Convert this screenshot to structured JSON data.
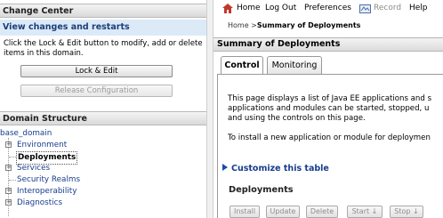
{
  "change_center": {
    "title": "Change Center",
    "view_changes": "View changes and restarts",
    "description": "Click the Lock & Edit button to modify, add or delete items in this domain.",
    "lock_edit_label": "Lock & Edit",
    "release_label": "Release Configuration"
  },
  "domain_structure": {
    "title": "Domain Structure",
    "root": "base_domain",
    "items": [
      {
        "label": "Environment",
        "expandable": true
      },
      {
        "label": "Deployments",
        "expandable": false,
        "selected": true
      },
      {
        "label": "Services",
        "expandable": true
      },
      {
        "label": "Security Realms",
        "expandable": false
      },
      {
        "label": "Interoperability",
        "expandable": true
      },
      {
        "label": "Diagnostics",
        "expandable": true
      }
    ]
  },
  "topbar": {
    "home": "Home",
    "logout": "Log Out",
    "preferences": "Preferences",
    "record": "Record",
    "help": "Help"
  },
  "breadcrumb": {
    "home": "Home",
    "separator": ">",
    "current": "Summary of Deployments"
  },
  "main": {
    "title": "Summary of Deployments",
    "tabs": [
      {
        "label": "Control",
        "active": true
      },
      {
        "label": "Monitoring",
        "active": false
      }
    ],
    "description_lines": [
      "This page displays a list of Java EE applications and s",
      "applications and modules can be started, stopped, u",
      "and using the controls on this page."
    ],
    "install_line": "To install a new application or module for deploymen",
    "customize_label": "Customize this table",
    "deployments_title": "Deployments",
    "table_buttons": [
      "Install",
      "Update",
      "Delete",
      "Start ↓",
      "Stop ↓"
    ]
  },
  "colors": {
    "link": "#173c8c",
    "view_changes_bg": "#dce9f7",
    "header_bg": "#dcdcdc"
  }
}
